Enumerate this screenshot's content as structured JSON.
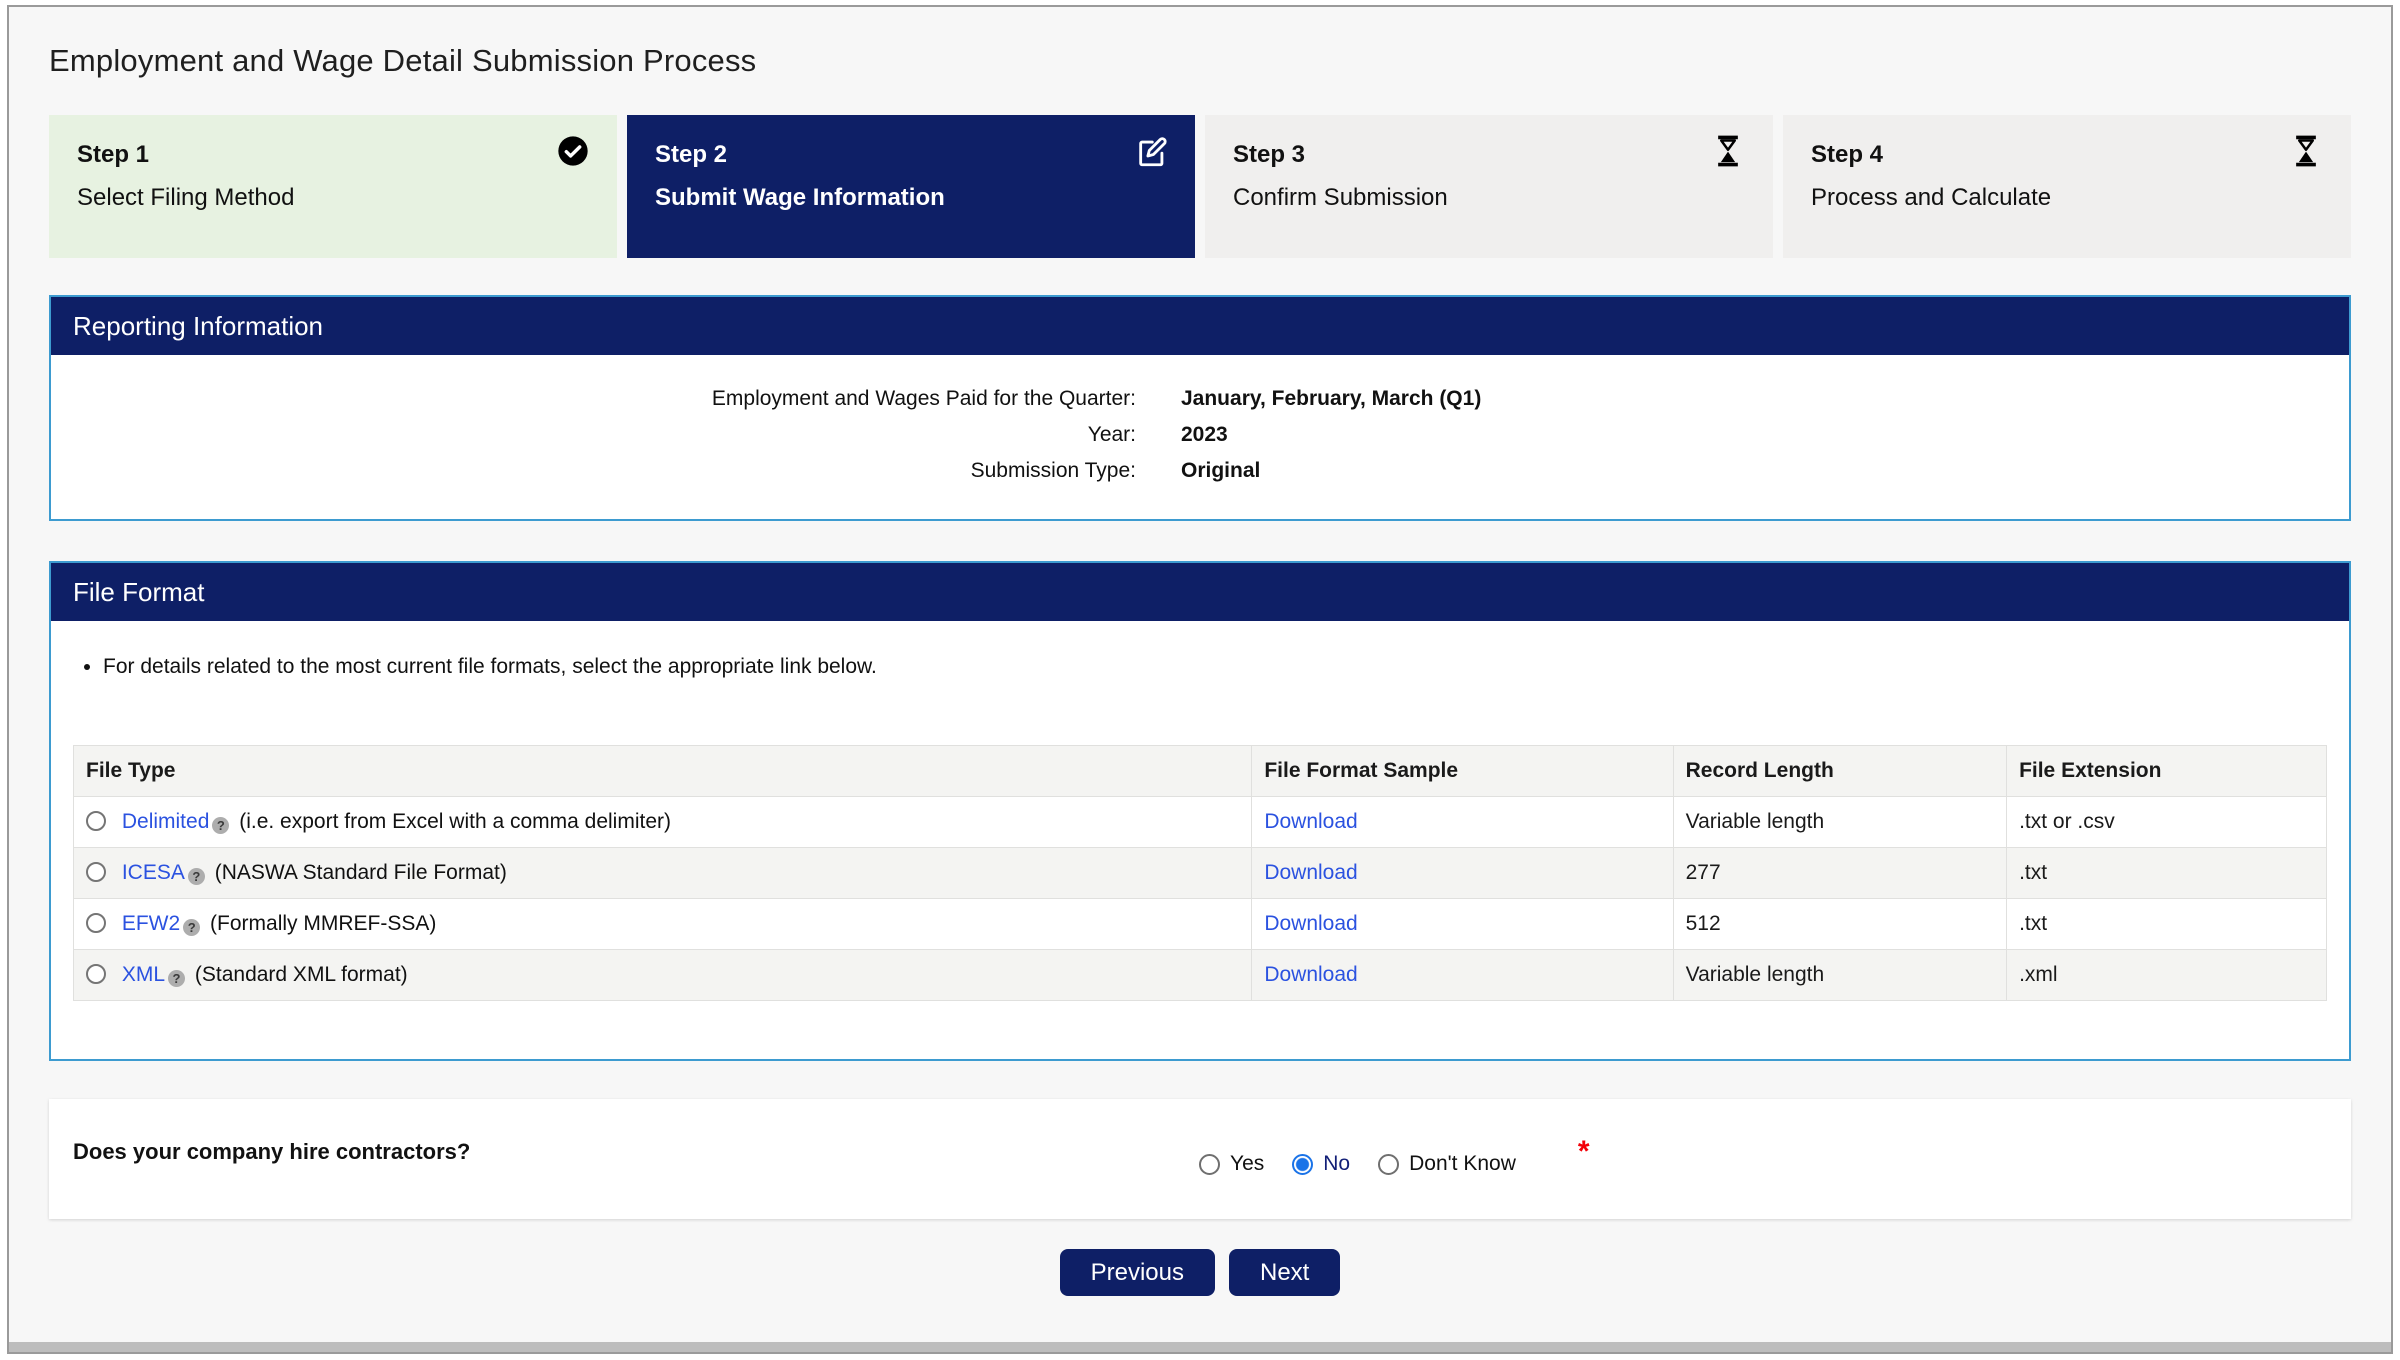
{
  "page": {
    "title": "Employment and Wage Detail Submission Process"
  },
  "steps": [
    {
      "step": "Step 1",
      "label": "Select Filing Method",
      "state": "complete",
      "icon": "check-circle"
    },
    {
      "step": "Step 2",
      "label": "Submit Wage Information",
      "state": "active",
      "icon": "edit-pencil-square"
    },
    {
      "step": "Step 3",
      "label": "Confirm Submission",
      "state": "pending",
      "icon": "hourglass"
    },
    {
      "step": "Step 4",
      "label": "Process and Calculate",
      "state": "pending",
      "icon": "hourglass"
    }
  ],
  "reporting": {
    "header": "Reporting Information",
    "rows": [
      {
        "label": "Employment and Wages Paid for the Quarter:",
        "value": "January, February, March (Q1)"
      },
      {
        "label": "Year:",
        "value": "2023"
      },
      {
        "label": "Submission Type:",
        "value": "Original"
      }
    ]
  },
  "file_format": {
    "header": "File Format",
    "note": "For details related to the most current file formats, select the appropriate link below.",
    "help_icon_glyph": "?",
    "table": {
      "columns": [
        "File Type",
        "File Format Sample",
        "Record Length",
        "File Extension"
      ],
      "rows": [
        {
          "link": "Delimited",
          "description": "(i.e. export from Excel with a comma delimiter)",
          "sample": "Download",
          "record_length": "Variable length",
          "extension": ".txt or .csv",
          "selected": false
        },
        {
          "link": "ICESA",
          "description": "(NASWA Standard File Format)",
          "sample": "Download",
          "record_length": "277",
          "extension": ".txt",
          "selected": false
        },
        {
          "link": "EFW2",
          "description": "(Formally MMREF-SSA)",
          "sample": "Download",
          "record_length": "512",
          "extension": ".txt",
          "selected": false
        },
        {
          "link": "XML",
          "description": "(Standard XML format)",
          "sample": "Download",
          "record_length": "Variable length",
          "extension": ".xml",
          "selected": false
        }
      ]
    }
  },
  "contractor_question": {
    "label": "Does your company hire contractors?",
    "options": [
      {
        "label": "Yes",
        "selected": false
      },
      {
        "label": "No",
        "selected": true
      },
      {
        "label": "Don't Know",
        "selected": false
      }
    ],
    "required_marker": "*"
  },
  "buttons": {
    "previous": "Previous",
    "next": "Next"
  },
  "colors": {
    "navy": "#0e1f66",
    "step_complete_bg": "#e7f2e1",
    "step_pending_bg": "#f0efee",
    "panel_border": "#3d9bd0",
    "link": "#2b52e0",
    "selected_radio": "#1a73e8",
    "required": "#f30008"
  }
}
